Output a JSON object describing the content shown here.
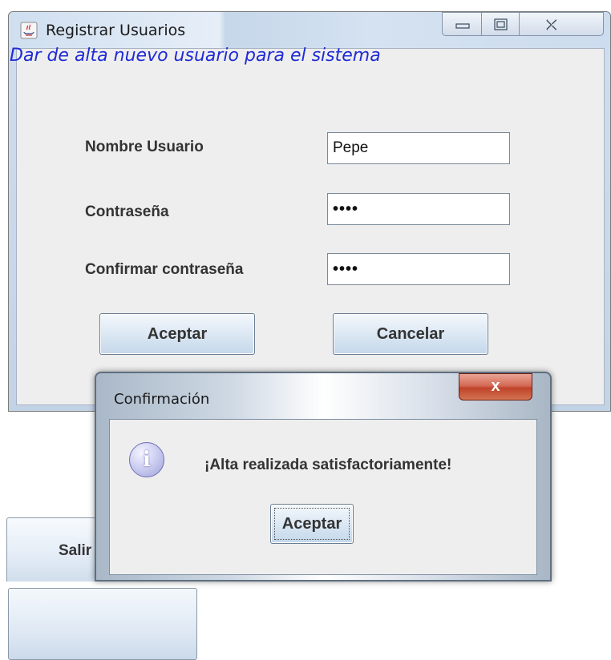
{
  "main_window": {
    "title": "Registrar Usuarios",
    "heading": "Dar de alta nuevo usuario para el sistema",
    "fields": [
      {
        "label": "Nombre Usuario",
        "value": "Pepe"
      },
      {
        "label": "Contraseña",
        "value": "••••"
      },
      {
        "label": "Confirmar contraseña",
        "value": "••••"
      }
    ],
    "buttons": {
      "accept": "Aceptar",
      "cancel": "Cancelar"
    }
  },
  "background_button": {
    "label": "Salir"
  },
  "dialog": {
    "title": "Confirmación",
    "close_symbol": "x",
    "message": "¡Alta realizada satisfactoriamente!",
    "ok_label": "Aceptar",
    "icon": "info-icon"
  },
  "colors": {
    "heading": "#1f2bd6",
    "close_button": "#c0432a"
  }
}
